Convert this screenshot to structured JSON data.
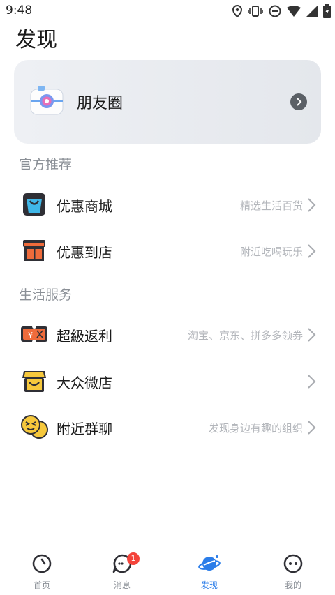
{
  "status_bar": {
    "time": "9:48"
  },
  "page": {
    "title": "发现"
  },
  "moments": {
    "label": "朋友圈"
  },
  "sections": [
    {
      "title": "官方推荐",
      "items": [
        {
          "label": "优惠商城",
          "desc": "精选生活百货",
          "icon": "shopping-bag-icon"
        },
        {
          "label": "优惠到店",
          "desc": "附近吃喝玩乐",
          "icon": "storefront-icon"
        }
      ]
    },
    {
      "title": "生活服务",
      "items": [
        {
          "label": "超級返利",
          "desc": "淘宝、京东、拼多多领券",
          "icon": "coupon-ticket-icon"
        },
        {
          "label": "大众微店",
          "desc": "",
          "icon": "shop-awning-icon"
        },
        {
          "label": "附近群聊",
          "desc": "发现身边有趣的组织",
          "icon": "group-chat-emoji-icon"
        }
      ]
    }
  ],
  "tabbar": {
    "tabs": [
      {
        "label": "首页",
        "icon": "home-face-icon",
        "active": false
      },
      {
        "label": "消息",
        "icon": "message-bubble-icon",
        "active": false,
        "badge": "1"
      },
      {
        "label": "发现",
        "icon": "planet-icon",
        "active": true
      },
      {
        "label": "我的",
        "icon": "profile-face-icon",
        "active": false
      }
    ]
  },
  "colors": {
    "accent": "#2b7de9",
    "badge": "#f4443b",
    "secondary_text": "#8a8f96"
  }
}
